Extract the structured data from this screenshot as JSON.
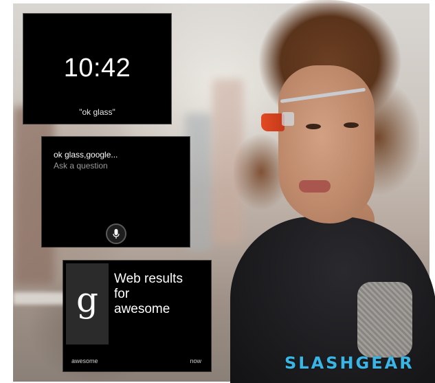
{
  "clock_card": {
    "time": "10:42",
    "hint": "\"ok glass\""
  },
  "voice_card": {
    "query": "ok glass,google...",
    "prompt": "Ask a question",
    "mic_icon": "microphone-icon"
  },
  "results_card": {
    "logo_letter": "g",
    "title_line1": "Web results",
    "title_line2": "for",
    "title_line3": "awesome",
    "footer_query": "awesome",
    "footer_time": "now"
  },
  "watermark": {
    "text": "SLASHGEAR"
  },
  "colors": {
    "card_background": "#000000",
    "watermark_blue": "#39b6e6",
    "glass_pod_orange": "#e34a22"
  }
}
